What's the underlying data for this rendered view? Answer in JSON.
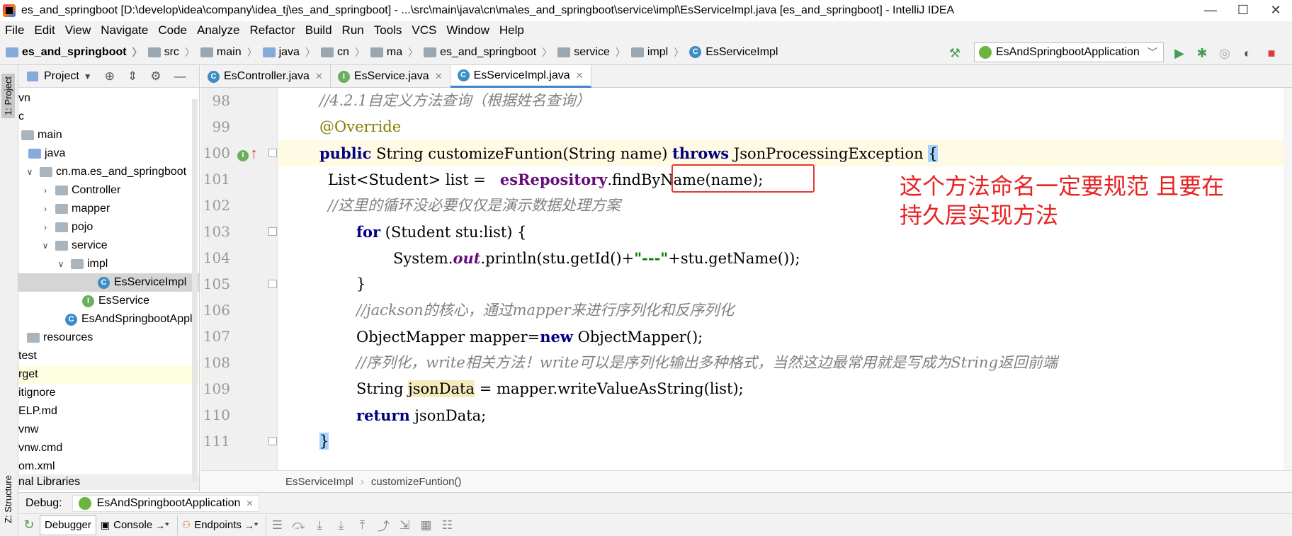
{
  "window": {
    "title": "es_and_springboot [D:\\develop\\idea\\company\\idea_tj\\es_and_springboot] - ...\\src\\main\\java\\cn\\ma\\es_and_springboot\\service\\impl\\EsServiceImpl.java [es_and_springboot] - IntelliJ IDEA",
    "minimize": "—",
    "maximize": "☐",
    "close": "✕"
  },
  "menu": [
    "File",
    "Edit",
    "View",
    "Navigate",
    "Code",
    "Analyze",
    "Refactor",
    "Build",
    "Run",
    "Tools",
    "VCS",
    "Window",
    "Help"
  ],
  "navbar": {
    "crumbs": [
      "es_and_springboot",
      "src",
      "main",
      "java",
      "cn",
      "ma",
      "es_and_springboot",
      "service",
      "impl",
      "EsServiceImpl"
    ],
    "run_config": "EsAndSpringbootApplication"
  },
  "sidebar": {
    "project_tab": "1: Project",
    "structure_tab": "Z: Structure"
  },
  "project_panel": {
    "title": "Project",
    "tree": [
      {
        "label": "vn"
      },
      {
        "label": "c"
      },
      {
        "label": "main"
      },
      {
        "label": "java"
      },
      {
        "label": "cn.ma.es_and_springboot"
      },
      {
        "label": "Controller"
      },
      {
        "label": "mapper"
      },
      {
        "label": "pojo"
      },
      {
        "label": "service"
      },
      {
        "label": "impl"
      },
      {
        "label": "EsServiceImpl"
      },
      {
        "label": "EsService"
      },
      {
        "label": "EsAndSpringbootAppli"
      },
      {
        "label": "resources"
      },
      {
        "label": "test"
      },
      {
        "label": "rget"
      },
      {
        "label": "itignore"
      },
      {
        "label": "ELP.md"
      },
      {
        "label": "vnw"
      },
      {
        "label": "vnw.cmd"
      },
      {
        "label": "om.xml"
      },
      {
        "label": "nal Libraries"
      }
    ]
  },
  "editor_tabs": [
    {
      "label": "EsController.java"
    },
    {
      "label": "EsService.java"
    },
    {
      "label": "EsServiceImpl.java"
    }
  ],
  "editor": {
    "line_numbers": [
      "98",
      "99",
      "100",
      "101",
      "102",
      "103",
      "104",
      "105",
      "106",
      "107",
      "108",
      "109",
      "110",
      "111"
    ],
    "lines": {
      "l98": "//4.2.1自定义方法查询（根据姓名查询）",
      "l99": "@Override",
      "l100_kw": "public",
      "l100_a": " String customizeFuntion(String name) ",
      "l100_throws": "throws",
      "l100_b": " JsonProcessingException ",
      "l100_brace": "{",
      "l101_a": "List<Student> list =   ",
      "l101_field": "esRepository",
      "l101_b": ".findByName(name);",
      "l102": "//这里的循环没必要仅仅是演示数据处理方案",
      "l103_kw": "for",
      "l103_a": " (Student stu:list) {",
      "l104_a": "System.",
      "l104_out": "out",
      "l104_b": ".println(stu.getId()+",
      "l104_str": "\"---\"",
      "l104_c": "+stu.getName());",
      "l105": "}",
      "l106": "//jackson的核心，通过mapper来进行序列化和反序列化",
      "l107_a": "ObjectMapper mapper=",
      "l107_kw": "new",
      "l107_b": " ObjectMapper();",
      "l108": "//序列化，write相关方法！write可以是序列化输出多种格式，当然这边最常用就是写成为String返回前端",
      "l109_a": "String ",
      "l109_var": "jsonData",
      "l109_b": " = mapper.writeValueAsString(list);",
      "l110_kw": "return",
      "l110_a": " jsonData;",
      "l111": "}"
    },
    "annotation_line1": "这个方法命名一定要规范 且要在",
    "annotation_line2": "持久层实现方法"
  },
  "editor_breadcrumb": [
    "EsServiceImpl",
    "customizeFuntion()"
  ],
  "debug": {
    "label": "Debug:",
    "session": "EsAndSpringbootApplication",
    "tabs": [
      "Debugger",
      "Console",
      "Endpoints"
    ]
  },
  "colors": {
    "keyword": "#000080",
    "comment": "#808080",
    "annotation": "#808000",
    "field": "#660e7a",
    "string": "#008000",
    "annotation_red": "#e82121"
  }
}
